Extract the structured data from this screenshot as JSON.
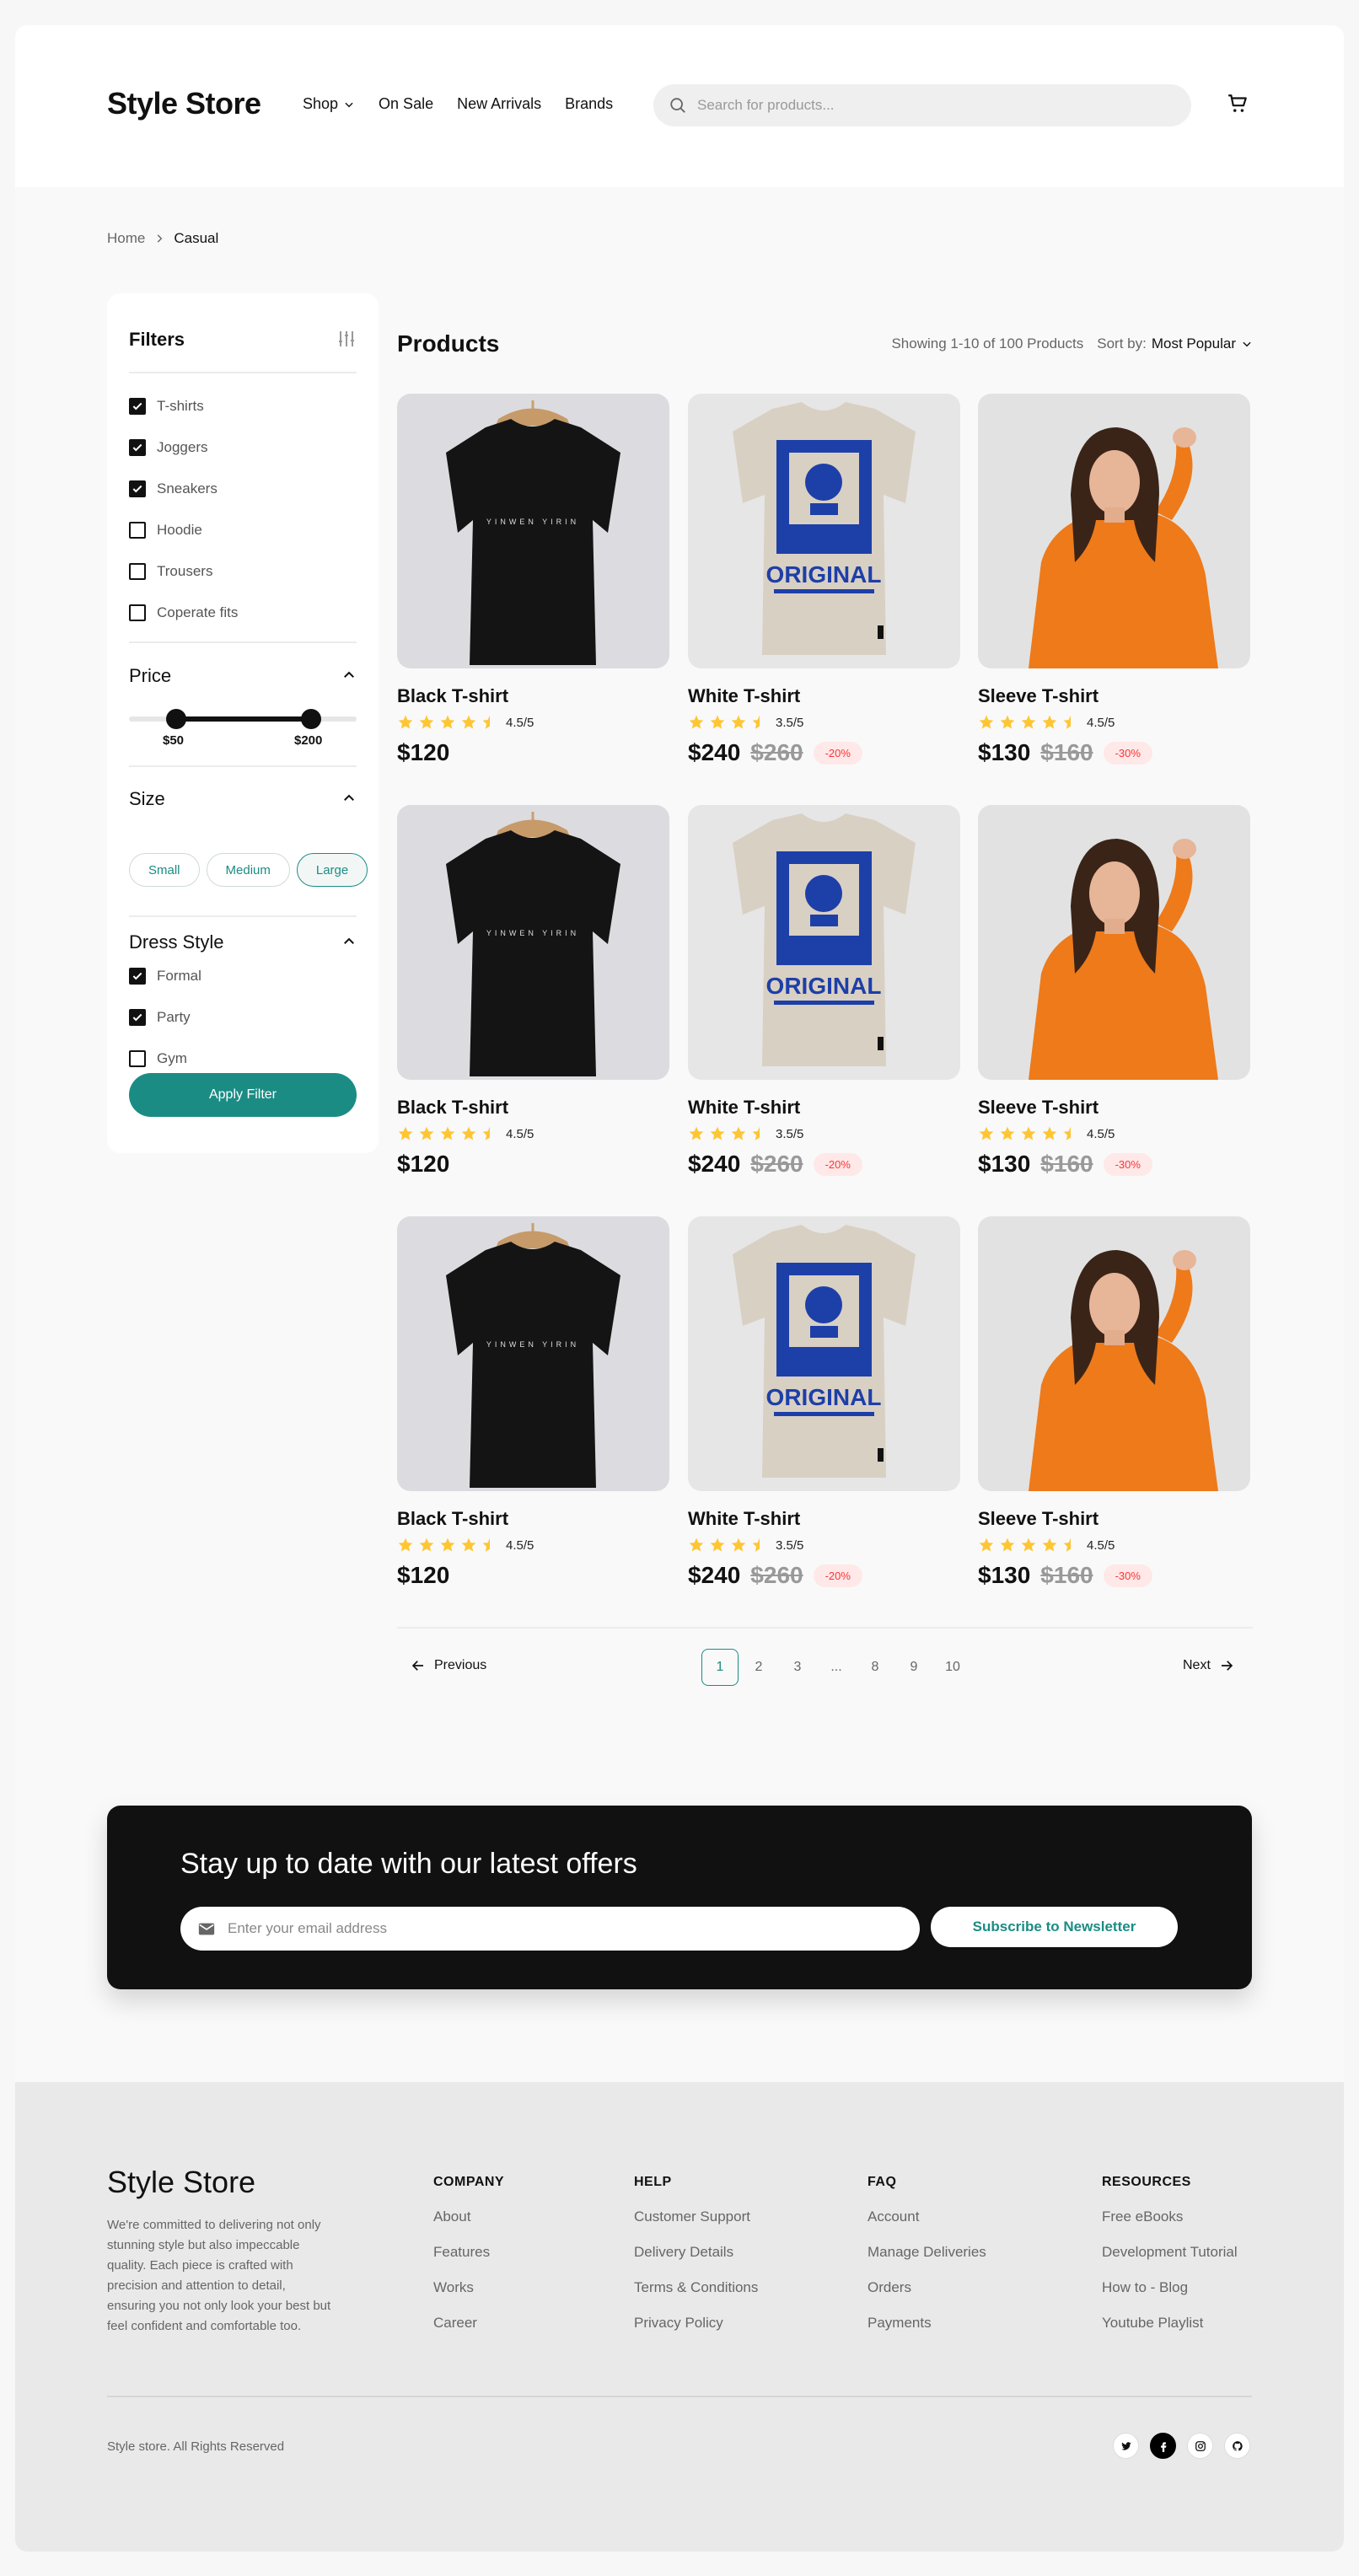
{
  "header": {
    "logo": "Style Store",
    "nav": [
      "Shop",
      "On Sale",
      "New Arrivals",
      "Brands"
    ],
    "search_placeholder": "Search for products..."
  },
  "breadcrumb": {
    "home": "Home",
    "current": "Casual"
  },
  "filters": {
    "title": "Filters",
    "categories": [
      {
        "label": "T-shirts",
        "checked": true
      },
      {
        "label": "Joggers",
        "checked": true
      },
      {
        "label": "Sneakers",
        "checked": true
      },
      {
        "label": "Hoodie",
        "checked": false
      },
      {
        "label": "Trousers",
        "checked": false
      },
      {
        "label": "Coperate fits",
        "checked": false
      }
    ],
    "price": {
      "title": "Price",
      "min_label": "$50",
      "max_label": "$200"
    },
    "size": {
      "title": "Size",
      "options": [
        "Small",
        "Medium",
        "Large"
      ],
      "selected": "Large"
    },
    "dress_style": {
      "title": "Dress Style",
      "options": [
        {
          "label": "Formal",
          "checked": true
        },
        {
          "label": "Party",
          "checked": true
        },
        {
          "label": "Gym",
          "checked": false
        }
      ]
    },
    "apply_label": "Apply Filter"
  },
  "products_section": {
    "title": "Products",
    "showing": "Showing 1-10 of 100 Products",
    "sort_label": "Sort by:",
    "sort_value": "Most Popular"
  },
  "products": [
    {
      "name": "Black T-shirt",
      "rating": "4.5/5",
      "stars": 4.5,
      "price": "$120",
      "old_price": "",
      "discount": "",
      "image": "black-tshirt"
    },
    {
      "name": "White T-shirt",
      "rating": "3.5/5",
      "stars": 3.5,
      "price": "$240",
      "old_price": "$260",
      "discount": "-20%",
      "image": "white-tshirt"
    },
    {
      "name": "Sleeve T-shirt",
      "rating": "4.5/5",
      "stars": 4.5,
      "price": "$130",
      "old_price": "$160",
      "discount": "-30%",
      "image": "orange-sweater"
    },
    {
      "name": "Black T-shirt",
      "rating": "4.5/5",
      "stars": 4.5,
      "price": "$120",
      "old_price": "",
      "discount": "",
      "image": "black-tshirt"
    },
    {
      "name": "White T-shirt",
      "rating": "3.5/5",
      "stars": 3.5,
      "price": "$240",
      "old_price": "$260",
      "discount": "-20%",
      "image": "white-tshirt"
    },
    {
      "name": "Sleeve T-shirt",
      "rating": "4.5/5",
      "stars": 4.5,
      "price": "$130",
      "old_price": "$160",
      "discount": "-30%",
      "image": "orange-sweater"
    },
    {
      "name": "Black T-shirt",
      "rating": "4.5/5",
      "stars": 4.5,
      "price": "$120",
      "old_price": "",
      "discount": "",
      "image": "black-tshirt"
    },
    {
      "name": "White T-shirt",
      "rating": "3.5/5",
      "stars": 3.5,
      "price": "$240",
      "old_price": "$260",
      "discount": "-20%",
      "image": "white-tshirt"
    },
    {
      "name": "Sleeve T-shirt",
      "rating": "4.5/5",
      "stars": 4.5,
      "price": "$130",
      "old_price": "$160",
      "discount": "-30%",
      "image": "orange-sweater"
    }
  ],
  "tshirt_print_text": {
    "black": "YINWEN YIRIN",
    "white": "ORIGINAL"
  },
  "pagination": {
    "previous": "Previous",
    "next": "Next",
    "pages": [
      "1",
      "2",
      "3",
      "...",
      "8",
      "9",
      "10"
    ],
    "current": "1"
  },
  "newsletter": {
    "title": "Stay up to date with our latest offers",
    "placeholder": "Enter your email address",
    "button": "Subscribe to Newsletter"
  },
  "footer": {
    "logo": "Style Store",
    "description": "We're committed to delivering not only stunning style but also impeccable quality. Each piece is crafted with precision and attention to detail, ensuring you not only look your best but feel confident and comfortable too.",
    "columns": [
      {
        "title": "COMPANY",
        "links": [
          "About",
          "Features",
          "Works",
          "Career"
        ]
      },
      {
        "title": "HELP",
        "links": [
          "Customer Support",
          "Delivery Details",
          "Terms & Conditions",
          "Privacy Policy"
        ]
      },
      {
        "title": "FAQ",
        "links": [
          "Account",
          "Manage Deliveries",
          "Orders",
          "Payments"
        ]
      },
      {
        "title": "RESOURCES",
        "links": [
          "Free eBooks",
          "Development Tutorial",
          "How to - Blog",
          "Youtube Playlist"
        ]
      }
    ],
    "copyright": "Style store. All Rights Reserved",
    "social": [
      "twitter-icon",
      "facebook-icon",
      "instagram-icon",
      "github-icon"
    ]
  },
  "colors": {
    "accent": "#1b8c84",
    "star": "#ffc633",
    "discount": "#ff3333",
    "newsletter_bg": "#111111"
  }
}
